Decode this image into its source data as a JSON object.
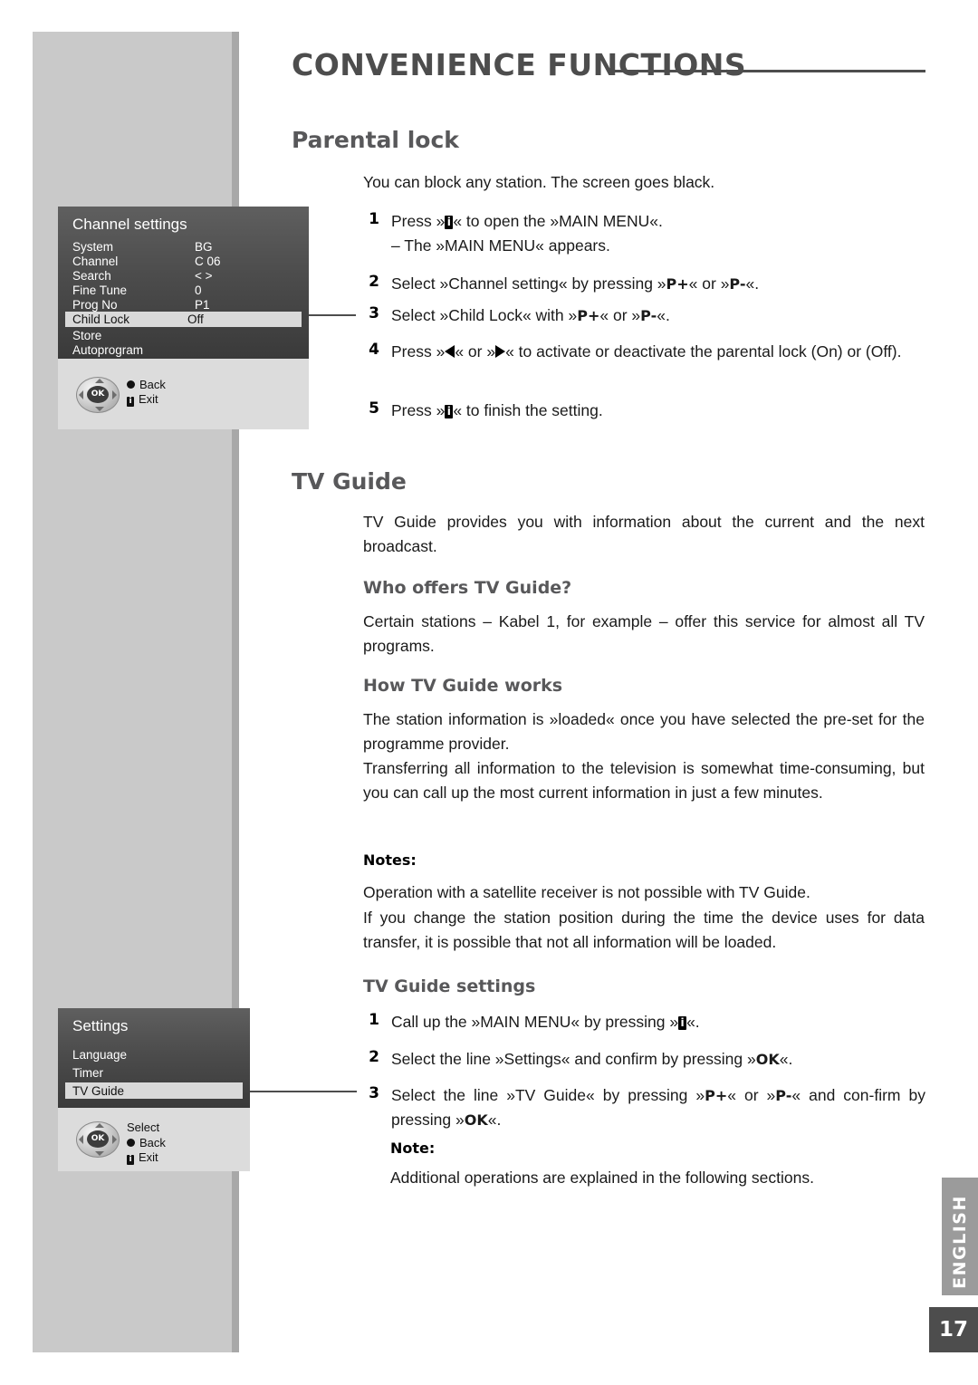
{
  "header": {
    "title": "CONVENIENCE FUNCTIONS"
  },
  "sections": {
    "parental": {
      "heading": "Parental lock",
      "intro": "You can block any station. The screen goes black.",
      "steps": [
        {
          "num": "1",
          "text": "Press »i« to open the »MAIN MENU«.",
          "sub": "– The »MAIN MENU« appears."
        },
        {
          "num": "2",
          "text": "Select »Channel setting« by pressing »P+« or »P-«."
        },
        {
          "num": "3",
          "text": "Select »Child Lock« with »P+« or »P-«."
        },
        {
          "num": "4",
          "text": "Press »◀« or »▶« to activate or deactivate the parental lock (On) or (Off)."
        },
        {
          "num": "5",
          "text": "Press »i« to finish the setting."
        }
      ]
    },
    "tvguide": {
      "heading": "TV Guide",
      "intro": "TV Guide provides you with information about the current and the next broadcast.",
      "who_heading": "Who offers TV Guide?",
      "who_text": "Certain stations – Kabel 1, for example – offer this service for almost all TV programs.",
      "how_heading": "How TV Guide works",
      "how_text_1": "The station information is »loaded« once you have selected the pre-set for the programme provider.",
      "how_text_2": "Transferring all information to the television is somewhat time-consuming, but you can call up the most current information in just a few minutes.",
      "notes_heading": "Notes:",
      "note_1": "Operation with a satellite receiver is not possible with TV Guide.",
      "note_2": "If you change the station position during the time the device uses for data transfer, it is possible that not all information will be loaded.",
      "settings_heading": "TV Guide settings",
      "settings_steps": [
        {
          "num": "1",
          "text": "Call up the »MAIN MENU« by pressing »i«."
        },
        {
          "num": "2",
          "text": "Select the line »Settings« and confirm by pressing »OK«."
        },
        {
          "num": "3",
          "text": "Select the line »TV Guide« by pressing »P+« or »P-« and confirm by pressing »OK«."
        }
      ],
      "note_heading": "Note:",
      "note_3": "Additional operations are explained in the following sections."
    }
  },
  "osd_channel_settings": {
    "title": "Channel settings",
    "rows": [
      {
        "label": "System",
        "value": "BG"
      },
      {
        "label": "Channel",
        "value": "C 06"
      },
      {
        "label": "Search",
        "value": "< >"
      },
      {
        "label": "Fine Tune",
        "value": "0"
      },
      {
        "label": "Prog No",
        "value": "P1"
      },
      {
        "label": "Child Lock",
        "value": "Off",
        "highlighted": true
      },
      {
        "label": "Store",
        "value": ""
      },
      {
        "label": "Autoprogram",
        "value": ""
      }
    ],
    "ok_label": "OK",
    "legend": [
      {
        "icon": "dot",
        "label": "Back"
      },
      {
        "icon": "info",
        "label": "Exit"
      }
    ]
  },
  "osd_settings": {
    "title": "Settings",
    "rows": [
      {
        "label": "Language",
        "value": ""
      },
      {
        "label": "Timer",
        "value": ""
      },
      {
        "label": "TV Guide",
        "value": "",
        "highlighted": true
      }
    ],
    "ok_label": "OK",
    "legend": [
      {
        "icon": "none",
        "label": "Select"
      },
      {
        "icon": "dot",
        "label": "Back"
      },
      {
        "icon": "info",
        "label": "Exit"
      }
    ]
  },
  "footer": {
    "language_tab": "ENGLISH",
    "page_number": "17"
  }
}
